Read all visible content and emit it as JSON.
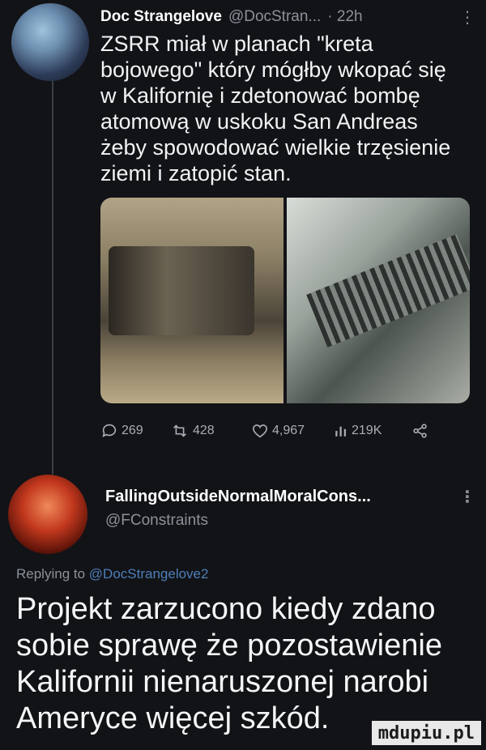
{
  "tweet": {
    "author_name": "Doc Strangelove",
    "author_handle": "@DocStran...",
    "time": "· 22h",
    "more_icon": "more-dots-icon",
    "text": "ZSRR miał w planach \"kreta bojowego\" który mógłby wkopać się w Kalifornię i zdetonować bombę atomową w uskoku San Andreas żeby spowodować wielkie trzęsienie ziemi i zatopić stan.",
    "actions": {
      "replies": "269",
      "retweets": "428",
      "likes": "4,967",
      "views": "219K"
    },
    "icons": [
      "reply-icon",
      "retweet-icon",
      "like-icon",
      "views-icon",
      "share-icon"
    ]
  },
  "reply": {
    "author_name": "FallingOutsideNormalMoralCons...",
    "author_handle": "@FConstraints",
    "replying_prefix": "Replying to",
    "replying_to": "@DocStrangelove2",
    "text": "Projekt zarzucono kiedy zdano sobie sprawę że pozostawienie Kalifornii nienaruszonej narobi Ameryce więcej szkód."
  },
  "watermark": "mdupiu.pl",
  "colors": {
    "background": "#121317",
    "secondary_text": "#8b9199",
    "mention": "#4e7fb8"
  }
}
